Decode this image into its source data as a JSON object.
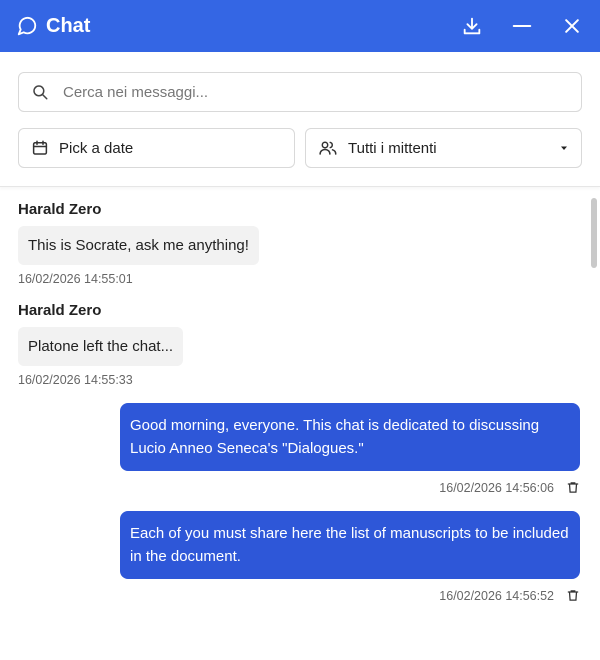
{
  "header": {
    "title": "Chat"
  },
  "search": {
    "placeholder": "Cerca nei messaggi..."
  },
  "filters": {
    "date_label": "Pick a date",
    "sender_label": "Tutti i mittenti"
  },
  "messages": [
    {
      "sender": "Harald Zero",
      "text": "This is Socrate, ask me anything!",
      "time": "16/02/2026 14:55:01"
    },
    {
      "sender": "Harald Zero",
      "text": "Platone left the chat...",
      "time": "16/02/2026 14:55:33"
    },
    {
      "text": "Good morning, everyone. This chat is dedicated to discussing Lucio Anneo Seneca's \"Dialogues.\"",
      "time": "16/02/2026 14:56:06"
    },
    {
      "text": "Each of you must share here the list of manuscripts to be included in the document.",
      "time": "16/02/2026 14:56:52"
    }
  ],
  "colors": {
    "header": "#3466e4",
    "outgoing_bubble": "#2e57d8",
    "incoming_bubble": "#f2f2f2"
  },
  "icons": {
    "chat": "chat-bubble-icon",
    "download": "download-icon",
    "minimize": "minimize-icon",
    "close": "close-icon",
    "search": "search-icon",
    "calendar": "calendar-icon",
    "users": "users-icon",
    "dropdown": "caret-down-icon",
    "delete": "trash-icon"
  }
}
